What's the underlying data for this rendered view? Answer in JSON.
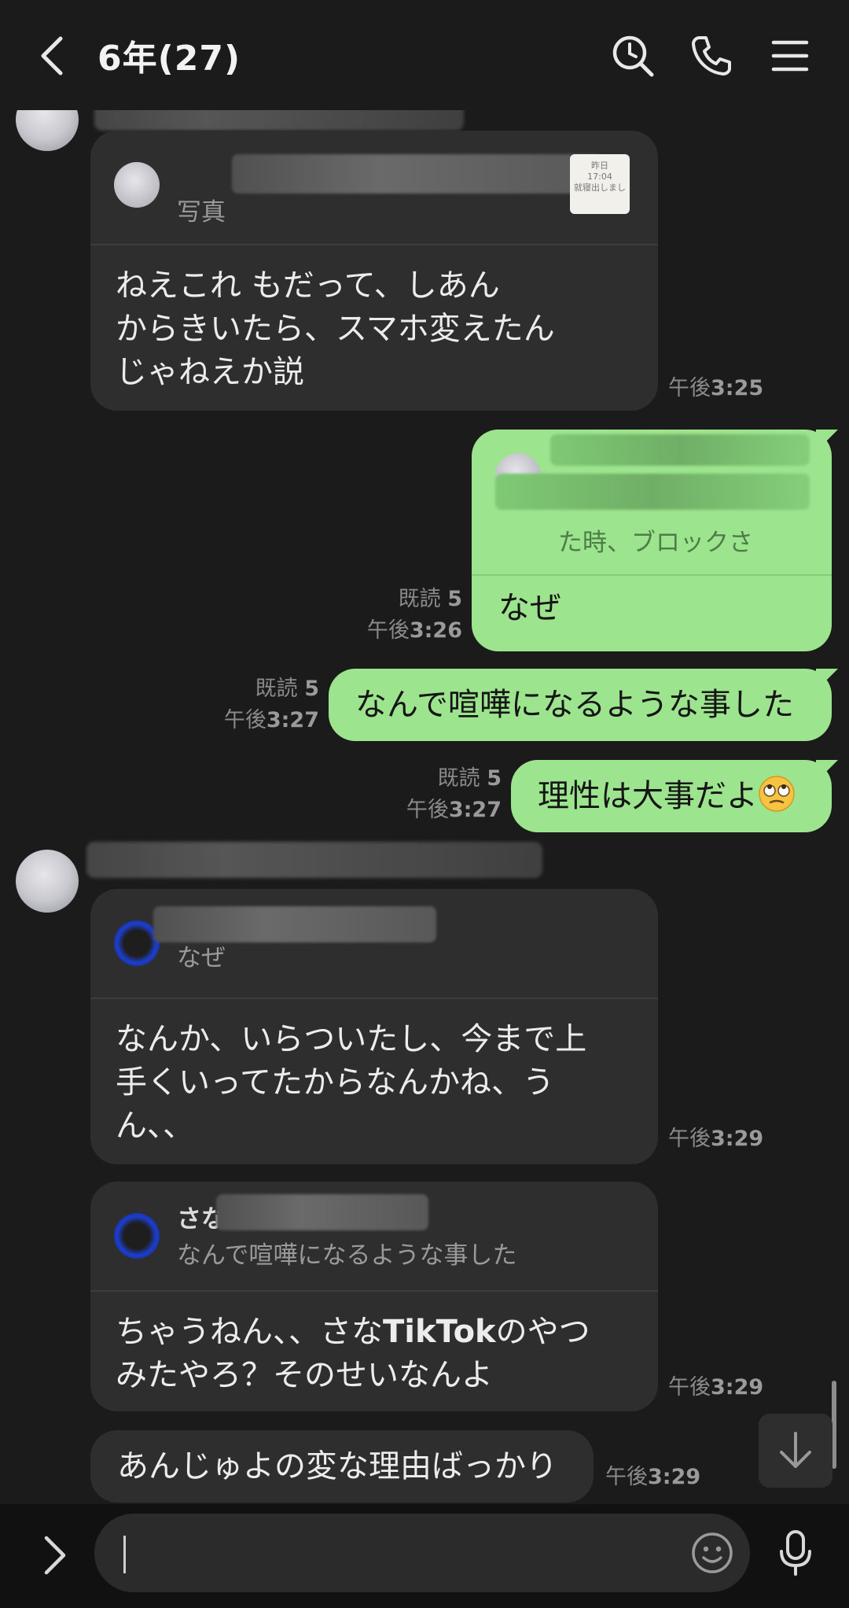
{
  "header": {
    "title": "6年(27)"
  },
  "messages": {
    "m1": {
      "reply_label": "写真",
      "thumb_text": "昨日\n17:04\n就寝出しまし",
      "text": "ねえこれ  もだって、しあん\nからきいたら、スマホ変えたん\nじゃねえか説",
      "time_prefix": "午後",
      "time": "3:25"
    },
    "m2": {
      "reply_text": "た時、ブロックさ",
      "text": "なぜ",
      "read_label": "既読",
      "read_count": "5",
      "time_prefix": "午後",
      "time": "3:26"
    },
    "m3": {
      "text": "なんで喧嘩になるような事した",
      "read_label": "既読",
      "read_count": "5",
      "time_prefix": "午後",
      "time": "3:27"
    },
    "m4": {
      "text": "理性は大事だよ",
      "emoji": "face-with-rolling-eyes",
      "read_label": "既読",
      "read_count": "5",
      "time_prefix": "午後",
      "time": "3:27"
    },
    "m5": {
      "reply_text": "なぜ",
      "text": "なんか、いらついたし、今まで上\n手くいってたからなんかね、う\nん、、",
      "time_prefix": "午後",
      "time": "3:29"
    },
    "m6": {
      "reply_name": "さな",
      "reply_text": "なんで喧嘩になるような事した",
      "text_pre": "ちゃうねん、、さな",
      "text_bold": "TikTok",
      "text_post": "のやつ\nみたやろ？そのせいなんよ",
      "time_prefix": "午後",
      "time": "3:29"
    },
    "m7": {
      "text": "あんじゅよの変な理由ばっかり",
      "time_prefix": "午後",
      "time": "3:29"
    }
  },
  "input": {
    "placeholder": ""
  },
  "icons": {
    "back": "chevron-left-icon",
    "search": "history-search-icon",
    "call": "phone-icon",
    "menu": "hamburger-icon",
    "expand": "chevron-right-icon",
    "emoji": "smiley-icon",
    "mic": "microphone-icon",
    "scroll_down": "arrow-down-icon"
  },
  "colors": {
    "background": "#1b1b1b",
    "incoming_bubble": "#2e2e2e",
    "outgoing_bubble": "#9de48f",
    "bottom_bar": "#111111"
  }
}
